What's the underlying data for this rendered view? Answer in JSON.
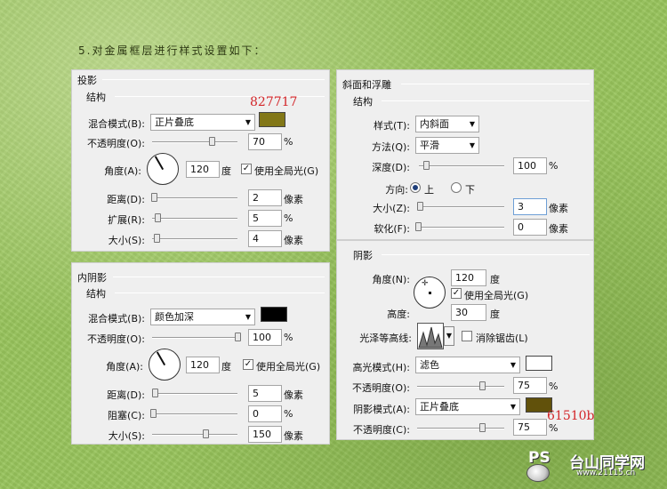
{
  "heading": "5.对金属框层进行样式设置如下：",
  "drop_shadow": {
    "title": "投影",
    "structure": "结构",
    "annotation": "827717",
    "blend_mode_label": "混合模式(B):",
    "blend_mode_value": "正片叠底",
    "swatch_color": "#827717",
    "opacity_label": "不透明度(O):",
    "opacity_value": "70",
    "opacity_unit": "%",
    "opacity_level": 0.7,
    "angle_label": "角度(A):",
    "angle_value": "120",
    "angle_unit": "度",
    "global_light_label": "使用全局光(G)",
    "global_light_checked": "✓",
    "distance_label": "距离(D):",
    "distance_value": "2",
    "distance_unit": "像素",
    "spread_label": "扩展(R):",
    "spread_value": "5",
    "spread_unit": "%",
    "size_label": "大小(S):",
    "size_value": "4",
    "size_unit": "像素"
  },
  "inner_shadow": {
    "title": "内阴影",
    "structure": "结构",
    "blend_mode_label": "混合模式(B):",
    "blend_mode_value": "颜色加深",
    "swatch_color": "#000000",
    "opacity_label": "不透明度(O):",
    "opacity_value": "100",
    "opacity_unit": "%",
    "opacity_level": 1.0,
    "angle_label": "角度(A):",
    "angle_value": "120",
    "angle_unit": "度",
    "global_light_label": "使用全局光(G)",
    "global_light_checked": "✓",
    "distance_label": "距离(D):",
    "distance_value": "5",
    "distance_unit": "像素",
    "choke_label": "阻塞(C):",
    "choke_value": "0",
    "choke_unit": "%",
    "size_label": "大小(S):",
    "size_value": "150",
    "size_unit": "像素"
  },
  "bevel": {
    "title": "斜面和浮雕",
    "structure": "结构",
    "style_label": "样式(T):",
    "style_value": "内斜面",
    "technique_label": "方法(Q):",
    "technique_value": "平滑",
    "depth_label": "深度(D):",
    "depth_value": "100",
    "depth_unit": "%",
    "direction_label": "方向:",
    "direction_up": "上",
    "direction_down": "下",
    "size_label": "大小(Z):",
    "size_value": "3",
    "size_unit": "像素",
    "soften_label": "软化(F):",
    "soften_value": "0",
    "soften_unit": "像素"
  },
  "shading": {
    "title": "阴影",
    "angle_label": "角度(N):",
    "angle_value": "120",
    "angle_unit": "度",
    "global_light_label": "使用全局光(G)",
    "global_light_checked": "✓",
    "altitude_label": "高度:",
    "altitude_value": "30",
    "altitude_unit": "度",
    "gloss_label": "光泽等高线:",
    "antialias_label": "消除锯齿(L)",
    "highlight_mode_label": "高光模式(H):",
    "highlight_mode_value": "滤色",
    "highlight_color": "#ffffff",
    "highlight_opacity_label": "不透明度(O):",
    "highlight_opacity_value": "75",
    "highlight_opacity_unit": "%",
    "shadow_mode_label": "阴影模式(A):",
    "shadow_mode_value": "正片叠底",
    "shadow_color": "#61510b",
    "annotation": "61510b",
    "shadow_opacity_label": "不透明度(C):",
    "shadow_opacity_value": "75",
    "shadow_opacity_unit": "%"
  },
  "watermark": {
    "brand": "PS",
    "site_name": "台山同学网",
    "url": "www.21115.cn"
  }
}
